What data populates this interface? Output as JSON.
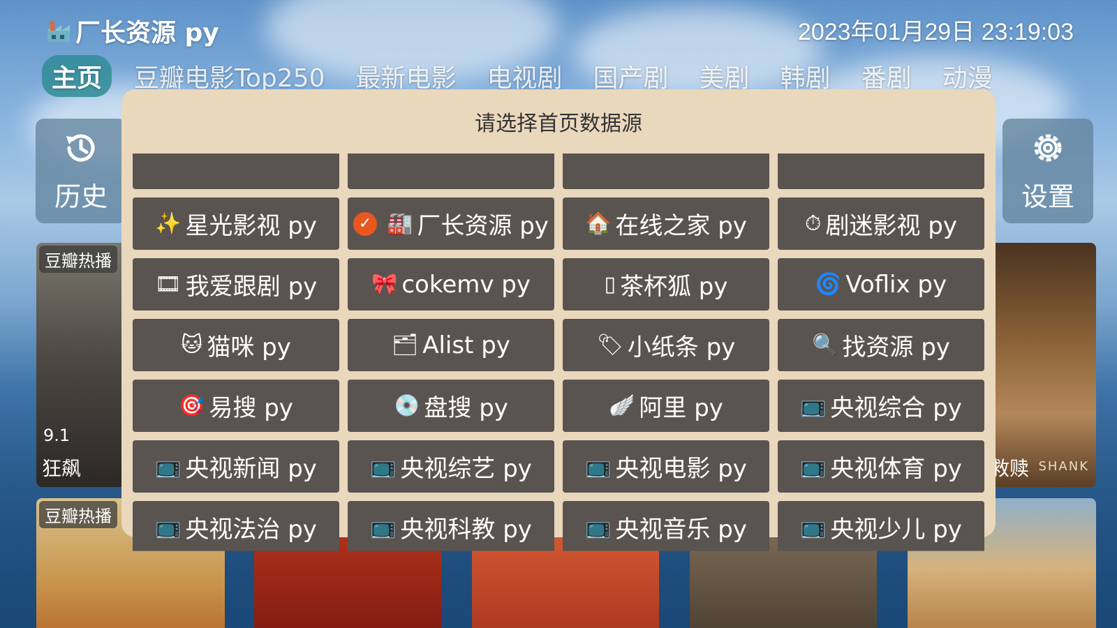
{
  "header": {
    "app_title": "厂长资源 py",
    "datetime": "2023年01月29日 23:19:03"
  },
  "nav": {
    "tabs": [
      {
        "label": "主页",
        "active": true
      },
      {
        "label": "豆瓣电影Top250"
      },
      {
        "label": "最新电影"
      },
      {
        "label": "电视剧"
      },
      {
        "label": "国产剧"
      },
      {
        "label": "美剧"
      },
      {
        "label": "韩剧"
      },
      {
        "label": "番剧"
      },
      {
        "label": "动漫"
      }
    ]
  },
  "side": {
    "history_label": "历史",
    "settings_label": "设置"
  },
  "posters": {
    "left_top": {
      "badge": "豆瓣热播",
      "rating": "9.1",
      "name": "狂飙"
    },
    "right_top": {
      "name": "救赎",
      "side_text": "SHANK"
    },
    "left_bottom": {
      "badge": "豆瓣热播"
    }
  },
  "dialog": {
    "title": "请选择首页数据源",
    "selected": "厂长资源 py",
    "options": [
      {
        "label": "",
        "icon": ""
      },
      {
        "label": "",
        "icon": ""
      },
      {
        "label": "",
        "icon": ""
      },
      {
        "label": "",
        "icon": ""
      },
      {
        "label": "星光影视 py",
        "icon": "✨"
      },
      {
        "label": "厂长资源 py",
        "icon": "🏭",
        "selected": true
      },
      {
        "label": "在线之家 py",
        "icon": "🏠"
      },
      {
        "label": "剧迷影视 py",
        "icon": "⏱"
      },
      {
        "label": "我爱跟剧 py",
        "icon": "🎞"
      },
      {
        "label": "cokemv py",
        "icon": "🎀"
      },
      {
        "label": "茶杯狐 py",
        "icon": "▯"
      },
      {
        "label": "Voflix py",
        "icon": "🌀"
      },
      {
        "label": "猫咪 py",
        "icon": "🐱"
      },
      {
        "label": "Alist py",
        "icon": "🗂"
      },
      {
        "label": "小纸条 py",
        "icon": "🏷"
      },
      {
        "label": "找资源 py",
        "icon": "🔍"
      },
      {
        "label": "易搜 py",
        "icon": "🎯"
      },
      {
        "label": "盘搜 py",
        "icon": "💿"
      },
      {
        "label": "阿里 py",
        "icon": "🪽"
      },
      {
        "label": "央视综合 py",
        "icon": "📺"
      },
      {
        "label": "央视新闻 py",
        "icon": "📺"
      },
      {
        "label": "央视综艺 py",
        "icon": "📺"
      },
      {
        "label": "央视电影 py",
        "icon": "📺"
      },
      {
        "label": "央视体育 py",
        "icon": "📺"
      },
      {
        "label": "央视法治 py",
        "icon": "📺"
      },
      {
        "label": "央视科教 py",
        "icon": "📺"
      },
      {
        "label": "央视音乐 py",
        "icon": "📺"
      },
      {
        "label": "央视少儿 py",
        "icon": "📺"
      }
    ]
  },
  "colors": {
    "dialog_bg": "#ead8bd",
    "option_bg": "#5a5450",
    "active_tab": "#308c96",
    "selected_check": "#e8571e"
  }
}
